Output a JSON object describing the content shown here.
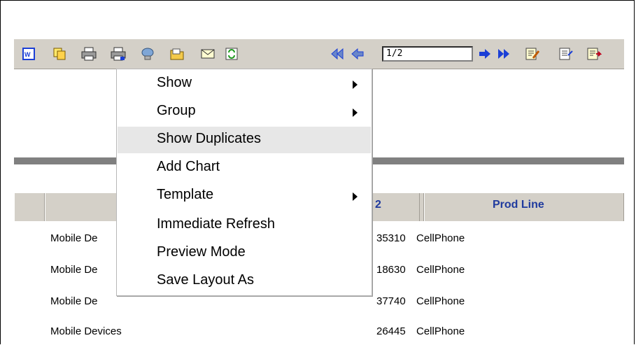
{
  "toolbar": {
    "page_indicator": "1/2",
    "icons": [
      "word-export-icon",
      "copy-icon",
      "print-icon",
      "print-preview-icon",
      "web-export-icon",
      "open-folder-icon",
      "email-icon",
      "refresh-icon",
      "first-page-icon",
      "previous-page-icon",
      "next-page-icon",
      "last-page-icon",
      "edit-report-icon",
      "properties-icon",
      "export-icon"
    ]
  },
  "context_menu": {
    "items": [
      {
        "label": "Show",
        "submenu": true
      },
      {
        "label": "Group",
        "submenu": true
      },
      {
        "label": "Show Duplicates",
        "submenu": false,
        "highlighted": true
      },
      {
        "label": "Add Chart",
        "submenu": false
      },
      {
        "label": "Template",
        "submenu": true
      },
      {
        "label": "Immediate Refresh",
        "submenu": false
      },
      {
        "label": "Preview Mode",
        "submenu": false
      },
      {
        "label": "Save Layout As",
        "submenu": false
      }
    ]
  },
  "table": {
    "headers": {
      "col2": "2",
      "col3": "Prod Line"
    },
    "rows": [
      {
        "category": "Mobile De",
        "value": "35310",
        "prod_line": "CellPhone"
      },
      {
        "category": "Mobile De",
        "value": "18630",
        "prod_line": "CellPhone"
      },
      {
        "category": "Mobile De",
        "value": "37740",
        "prod_line": "CellPhone"
      },
      {
        "category": "Mobile Devices",
        "value": "26445",
        "prod_line": "CellPhone"
      }
    ]
  },
  "colors": {
    "header_text": "#1f3a9e",
    "toolbar_bg": "#d4d0c8",
    "menu_highlight": "#e7e7e7",
    "arrow_blue": "#1b3fd6"
  }
}
